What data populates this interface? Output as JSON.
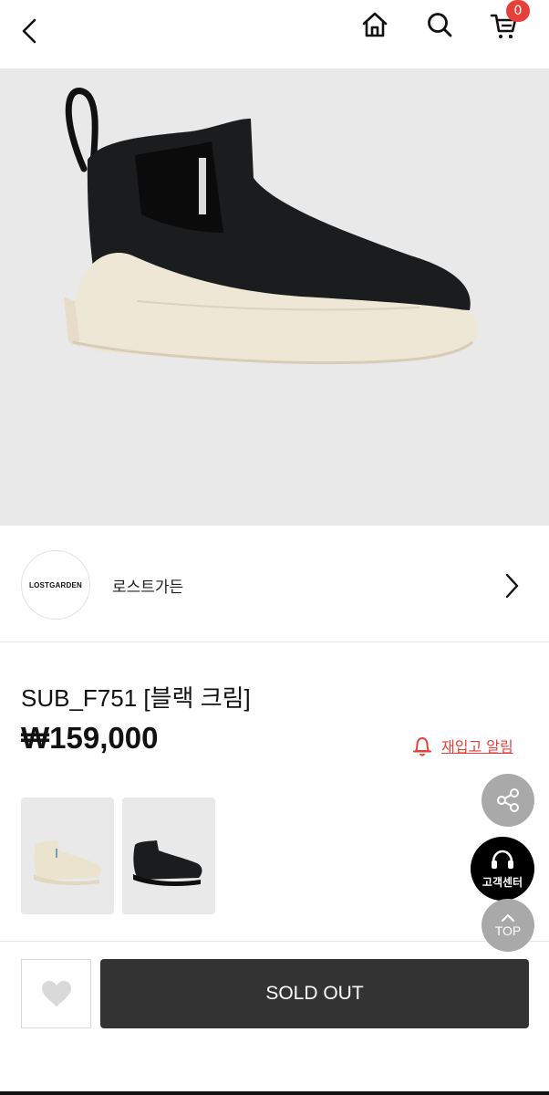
{
  "header": {
    "back_icon": "chevron-left-icon",
    "home_icon": "home-icon",
    "search_icon": "search-icon",
    "cart_icon": "cart-icon",
    "cart_count": "0"
  },
  "hero": {
    "image": "black rubber chelsea boot with cream sole"
  },
  "brand": {
    "logo_text": "LOSTGARDEN",
    "name": "로스트가든",
    "arrow_icon": "chevron-right-icon"
  },
  "product": {
    "name": "SUB_F751 [블랙 크림]",
    "price": "₩159,000",
    "restock_label": "재입고 알림",
    "restock_icon": "bell-icon"
  },
  "thumbnails": [
    {
      "variant": "cream boot"
    },
    {
      "variant": "black boot"
    }
  ],
  "floating": {
    "share_icon": "share-icon",
    "customer_center_label": "고객센터",
    "customer_center_icon": "headset-icon",
    "top_label": "TOP",
    "top_icon": "chevron-up-icon"
  },
  "bottom_bar": {
    "wish_icon": "heart-icon",
    "soldout_label": "SOLD OUT"
  },
  "colors": {
    "accent_red": "#e5403a",
    "dark_button": "#333333",
    "fab_gray": "#a9a9a9",
    "hero_bg": "#e9e9e9"
  }
}
